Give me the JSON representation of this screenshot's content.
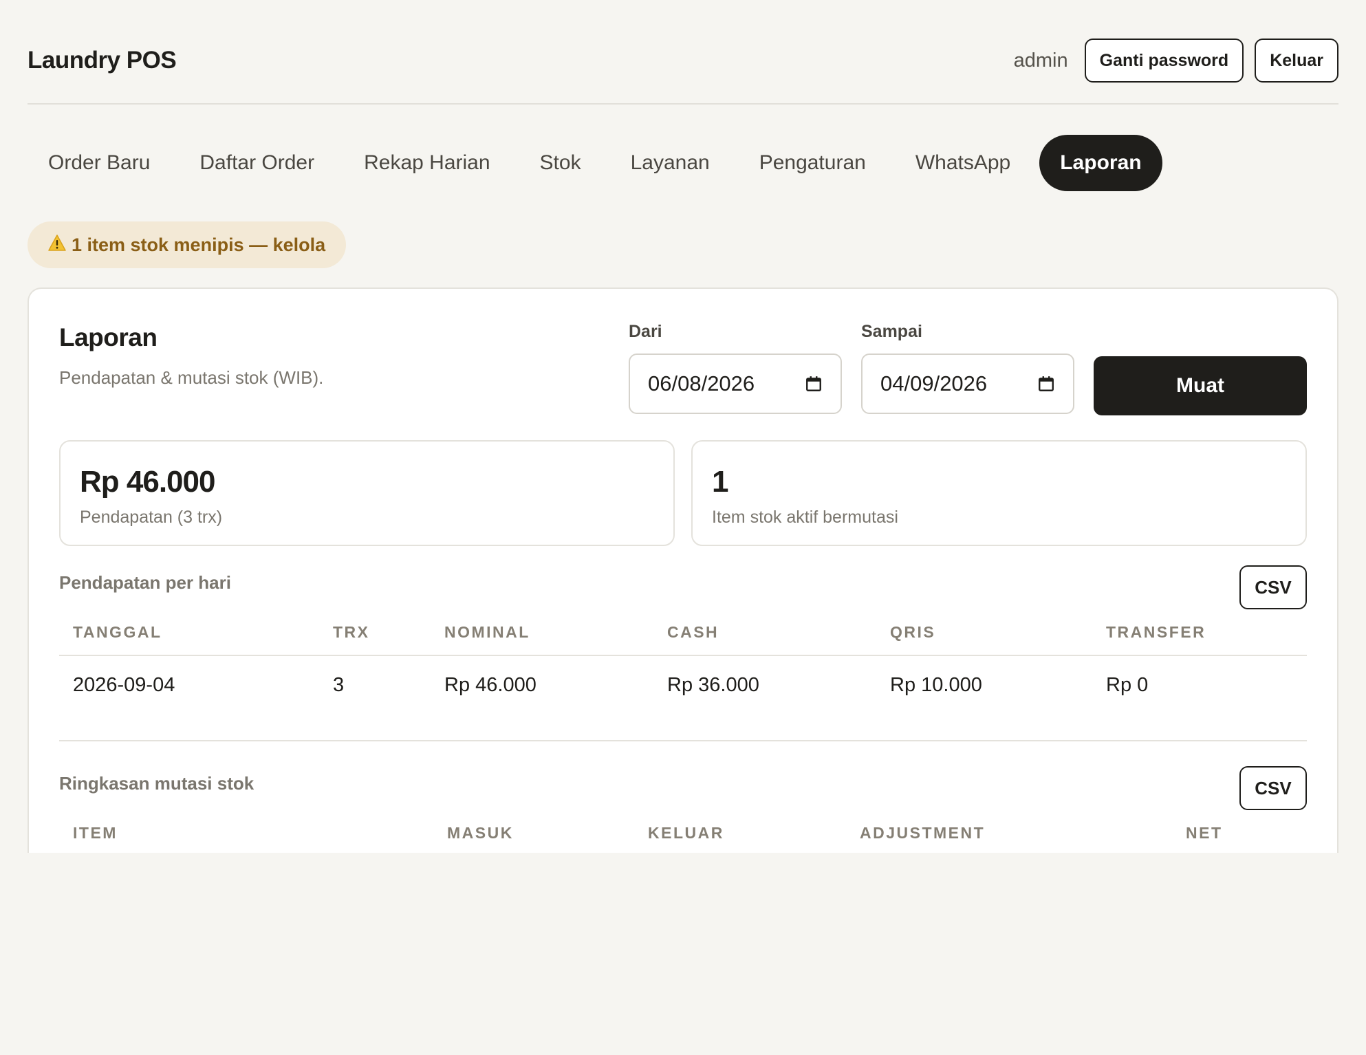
{
  "header": {
    "app_title": "Laundry POS",
    "username": "admin",
    "change_password_label": "Ganti password",
    "logout_label": "Keluar"
  },
  "nav": {
    "tabs": [
      {
        "label": "Order Baru"
      },
      {
        "label": "Daftar Order"
      },
      {
        "label": "Rekap Harian"
      },
      {
        "label": "Stok"
      },
      {
        "label": "Layanan"
      },
      {
        "label": "Pengaturan"
      },
      {
        "label": "WhatsApp"
      },
      {
        "label": "Laporan",
        "active": true
      }
    ]
  },
  "alert": {
    "icon": "warning-icon",
    "text": "1 item stok menipis — kelola"
  },
  "report": {
    "title": "Laporan",
    "subtitle": "Pendapatan & mutasi stok (WIB).",
    "from_label": "Dari",
    "from_value": "06/08/2026",
    "to_label": "Sampai",
    "to_value": "04/09/2026",
    "load_label": "Muat"
  },
  "stats": {
    "revenue_value": "Rp 46.000",
    "revenue_label": "Pendapatan (3 trx)",
    "items_value": "1",
    "items_label": "Item stok aktif bermutasi"
  },
  "daily_revenue": {
    "title": "Pendapatan per hari",
    "csv_label": "CSV",
    "columns": [
      "TANGGAL",
      "TRX",
      "NOMINAL",
      "CASH",
      "QRIS",
      "TRANSFER"
    ],
    "rows": [
      [
        "2026-09-04",
        "3",
        "Rp 46.000",
        "Rp 36.000",
        "Rp 10.000",
        "Rp 0"
      ]
    ]
  },
  "stock_summary": {
    "title": "Ringkasan mutasi stok",
    "csv_label": "CSV",
    "columns": [
      "ITEM",
      "MASUK",
      "KELUAR",
      "ADJUSTMENT",
      "NET"
    ]
  },
  "colors": {
    "background": "#f6f5f1",
    "primary": "#1f1e1b",
    "alert_bg": "#f3e9d6",
    "alert_text": "#8a5e16"
  }
}
